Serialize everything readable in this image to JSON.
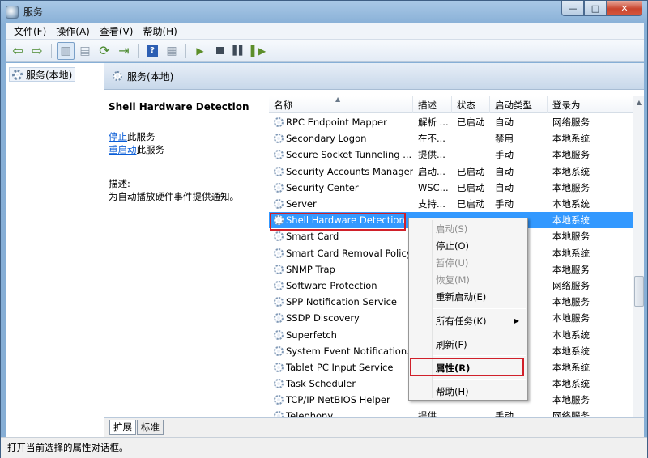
{
  "window": {
    "title": "服务",
    "icon": "services-gear-icon",
    "controls": [
      "—",
      "□",
      "✕"
    ]
  },
  "menubar": {
    "items": [
      "文件(F)",
      "操作(A)",
      "查看(V)",
      "帮助(H)"
    ]
  },
  "tree": {
    "root": "服务(本地)"
  },
  "panel": {
    "header": "服务(本地)"
  },
  "detail": {
    "title": "Shell Hardware Detection",
    "stop_link": "停止",
    "stop_suffix": "此服务",
    "restart_link": "重启动",
    "restart_suffix": "此服务",
    "desc_label": "描述:",
    "desc_text": "为自动播放硬件事件提供通知。"
  },
  "columns": [
    "名称",
    "描述",
    "状态",
    "启动类型",
    "登录为"
  ],
  "services": [
    {
      "name": "RPC Endpoint Mapper",
      "desc": "解析 ...",
      "status": "已启动",
      "start": "自动",
      "logon": "网络服务"
    },
    {
      "name": "Secondary Logon",
      "desc": "在不...",
      "status": "",
      "start": "禁用",
      "logon": "本地系统"
    },
    {
      "name": "Secure Socket Tunneling ...",
      "desc": "提供...",
      "status": "",
      "start": "手动",
      "logon": "本地服务"
    },
    {
      "name": "Security Accounts Manager",
      "desc": "启动...",
      "status": "已启动",
      "start": "自动",
      "logon": "本地系统"
    },
    {
      "name": "Security Center",
      "desc": "WSC...",
      "status": "已启动",
      "start": "自动",
      "logon": "本地服务"
    },
    {
      "name": "Server",
      "desc": "支持...",
      "status": "已启动",
      "start": "手动",
      "logon": "本地系统"
    },
    {
      "name": "Shell Hardware Detection",
      "desc": "",
      "status": "",
      "start": "",
      "logon": "本地系统",
      "selected": true
    },
    {
      "name": "Smart Card",
      "desc": "",
      "status": "",
      "start": "",
      "logon": "本地服务"
    },
    {
      "name": "Smart Card Removal Policy",
      "desc": "",
      "status": "",
      "start": "",
      "logon": "本地系统"
    },
    {
      "name": "SNMP Trap",
      "desc": "",
      "status": "",
      "start": "",
      "logon": "本地服务"
    },
    {
      "name": "Software Protection",
      "desc": "",
      "status": "",
      "start": "",
      "logon": "网络服务"
    },
    {
      "name": "SPP Notification Service",
      "desc": "",
      "status": "",
      "start": "",
      "logon": "本地服务"
    },
    {
      "name": "SSDP Discovery",
      "desc": "",
      "status": "",
      "start": "",
      "logon": "本地服务"
    },
    {
      "name": "Superfetch",
      "desc": "",
      "status": "",
      "start": "",
      "logon": "本地系统"
    },
    {
      "name": "System Event Notification...",
      "desc": "",
      "status": "",
      "start": "",
      "logon": "本地系统"
    },
    {
      "name": "Tablet PC Input Service",
      "desc": "",
      "status": "",
      "start": "",
      "logon": "本地系统"
    },
    {
      "name": "Task Scheduler",
      "desc": "",
      "status": "",
      "start": "",
      "logon": "本地系统"
    },
    {
      "name": "TCP/IP NetBIOS Helper",
      "desc": "",
      "status": "",
      "start": "",
      "logon": "本地服务"
    },
    {
      "name": "Telephony",
      "desc": "提供...",
      "status": "",
      "start": "手动",
      "logon": "网络服务"
    }
  ],
  "context_menu": {
    "start": "启动(S)",
    "stop": "停止(O)",
    "pause": "暂停(U)",
    "resume": "恢复(M)",
    "restart": "重新启动(E)",
    "all_tasks": "所有任务(K)",
    "refresh": "刷新(F)",
    "properties": "属性(R)",
    "help": "帮助(H)"
  },
  "tabs": [
    "扩展",
    "标准"
  ],
  "statusbar": {
    "text": "打开当前选择的属性对话框。"
  },
  "colors": {
    "selection": "#3399ff",
    "highlight_box": "#d0202a",
    "link": "#0b5ed7"
  }
}
